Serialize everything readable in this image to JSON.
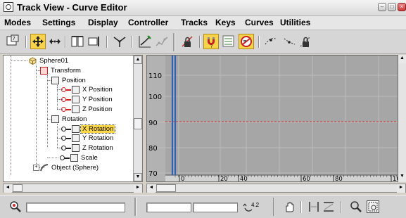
{
  "window": {
    "title": "Track View - Curve Editor"
  },
  "title_buttons": [
    "minimize",
    "maximize",
    "close"
  ],
  "menu": [
    "Modes",
    "Settings",
    "Display",
    "Controller",
    "Tracks",
    "Keys",
    "Curves",
    "Utilities"
  ],
  "toolbar": {
    "icons": [
      "filters-icon",
      "move-keys-icon",
      "slide-keys-icon",
      "insert-keys-icon",
      "scale-keys-icon",
      "scale-values-icon",
      "draw-curves-icon",
      "reduce-keys-icon",
      "lock-selection-icon",
      "snap-frames-icon",
      "parameter-curve-out-of-range-icon",
      "show-keyable-icons-icon",
      "tangent-auto-icon",
      "tangent-linear-icon",
      "lock-tangents-icon"
    ]
  },
  "tree": {
    "items": [
      {
        "label": "Sphere01",
        "level": 0
      },
      {
        "label": "Transform",
        "level": 1
      },
      {
        "label": "Position",
        "level": 2
      },
      {
        "label": "X Position",
        "level": 3
      },
      {
        "label": "Y Position",
        "level": 3
      },
      {
        "label": "Z Position",
        "level": 3
      },
      {
        "label": "Rotation",
        "level": 2
      },
      {
        "label": "X Rotation",
        "level": 3,
        "selected": true
      },
      {
        "label": "Y Rotation",
        "level": 3
      },
      {
        "label": "Z Rotation",
        "level": 3
      },
      {
        "label": "Scale",
        "level": 2
      },
      {
        "label": "Object (Sphere)",
        "level": 1
      }
    ]
  },
  "graph": {
    "y_ticks": [
      "110",
      "100",
      "90",
      "80",
      "70"
    ],
    "x_ticks": [
      "0",
      "20",
      "40",
      "60",
      "80",
      "10"
    ],
    "colors": {
      "background": "#a6a6a6",
      "grid": "#bcbcbc",
      "time_slider": "#2d63b8",
      "curve": "#c03030"
    }
  },
  "status": {
    "zoom_value": "4.2"
  }
}
